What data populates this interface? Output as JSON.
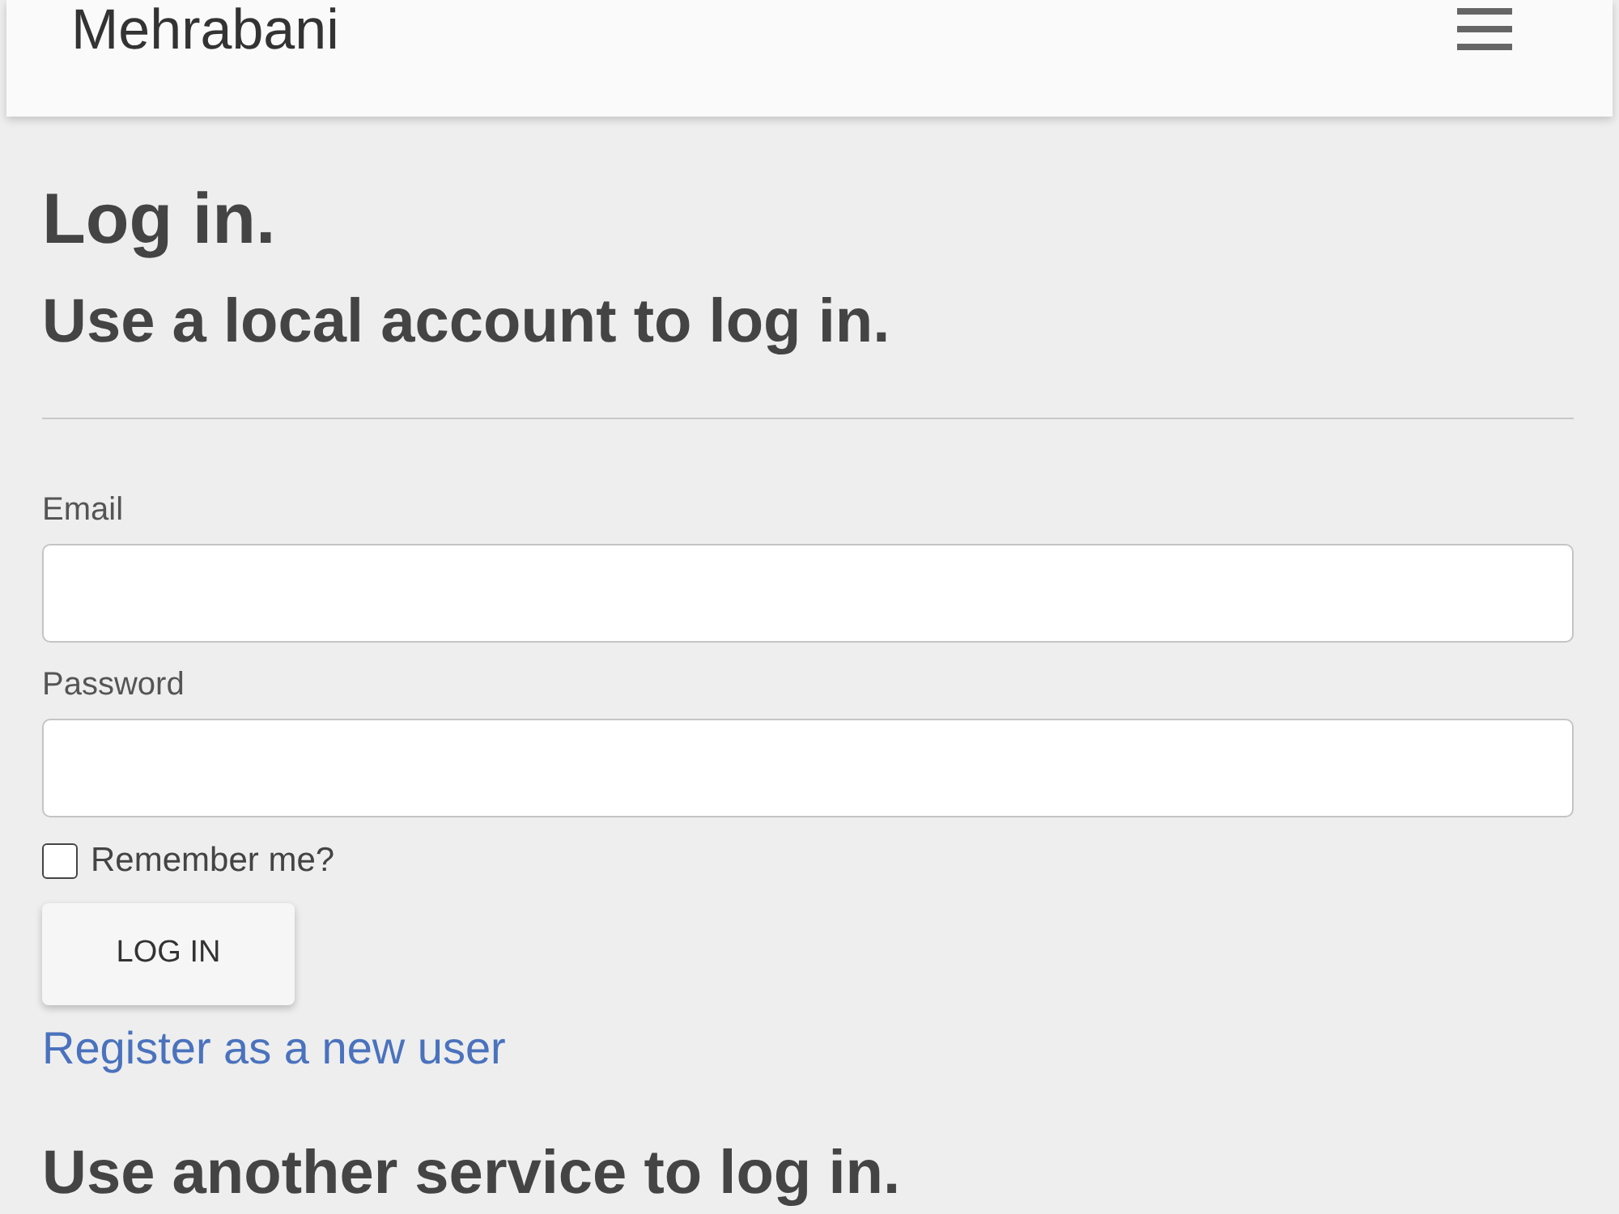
{
  "navbar": {
    "brand": "Mehrabani"
  },
  "page": {
    "title": "Log in.",
    "subtitle": "Use a local account to log in.",
    "form": {
      "fields": [
        {
          "label": "Email"
        },
        {
          "label": "Password"
        }
      ],
      "remember": {
        "label": "Remember me?",
        "checked": false
      },
      "submit": "LOG IN"
    },
    "register_link": "Register as a new user",
    "external_heading": "Use another service to log in."
  }
}
